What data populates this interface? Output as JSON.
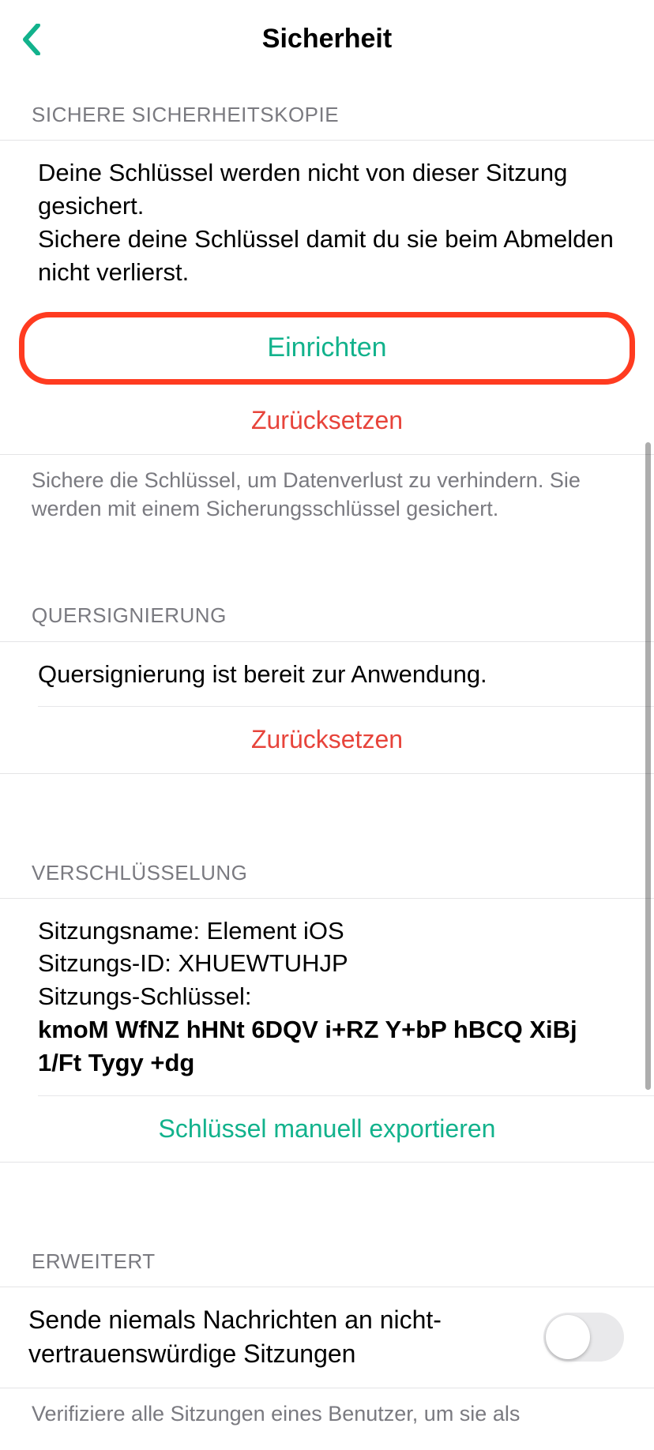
{
  "header": {
    "title": "Sicherheit"
  },
  "backup": {
    "section_title": "SICHERE SICHERHEITSKOPIE",
    "body_line1": "Deine Schlüssel werden nicht von dieser Sitzung gesichert.",
    "body_line2": "Sichere deine Schlüssel damit du sie beim Abmelden nicht verlierst.",
    "setup_label": "Einrichten",
    "reset_label": "Zurücksetzen",
    "footer": "Sichere die Schlüssel, um Datenverlust zu verhindern. Sie werden mit einem Sicherungsschlüssel gesichert."
  },
  "crosssign": {
    "section_title": "QUERSIGNIERUNG",
    "body": "Quersignierung ist bereit zur Anwendung.",
    "reset_label": "Zurücksetzen"
  },
  "encryption": {
    "section_title": "VERSCHLÜSSELUNG",
    "session_name_label": "Sitzungsname: ",
    "session_name_value": "Element iOS",
    "session_id_label": "Sitzungs-ID: ",
    "session_id_value": "XHUEWTUHJP",
    "session_key_label": "Sitzungs-Schlüssel:",
    "session_key_value": "kmoM WfNZ hHNt 6DQV i+RZ Y+bP hBCQ XiBj 1/Ft Tygy +dg",
    "export_label": "Schlüssel manuell exportieren"
  },
  "advanced": {
    "section_title": "ERWEITERT",
    "never_send_label": "Sende niemals Nachrichten an nicht-vertrauenswürdige Sitzungen",
    "footer": "Verifiziere alle Sitzungen eines Benutzer, um sie als"
  }
}
